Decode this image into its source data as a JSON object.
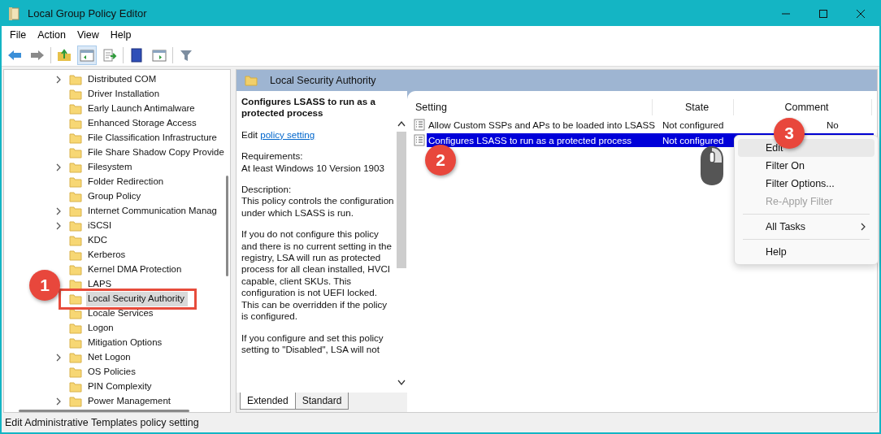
{
  "window": {
    "title": "Local Group Policy Editor"
  },
  "menu": [
    "File",
    "Action",
    "View",
    "Help"
  ],
  "tree": {
    "items": [
      {
        "label": "Distributed COM",
        "expandable": true,
        "selected": false
      },
      {
        "label": "Driver Installation",
        "expandable": false,
        "selected": false
      },
      {
        "label": "Early Launch Antimalware",
        "expandable": false,
        "selected": false
      },
      {
        "label": "Enhanced Storage Access",
        "expandable": false,
        "selected": false
      },
      {
        "label": "File Classification Infrastructure",
        "expandable": false,
        "selected": false
      },
      {
        "label": "File Share Shadow Copy Provide",
        "expandable": false,
        "selected": false
      },
      {
        "label": "Filesystem",
        "expandable": true,
        "selected": false
      },
      {
        "label": "Folder Redirection",
        "expandable": false,
        "selected": false
      },
      {
        "label": "Group Policy",
        "expandable": false,
        "selected": false
      },
      {
        "label": "Internet Communication Manag",
        "expandable": true,
        "selected": false
      },
      {
        "label": "iSCSI",
        "expandable": true,
        "selected": false
      },
      {
        "label": "KDC",
        "expandable": false,
        "selected": false
      },
      {
        "label": "Kerberos",
        "expandable": false,
        "selected": false
      },
      {
        "label": "Kernel DMA Protection",
        "expandable": false,
        "selected": false
      },
      {
        "label": "LAPS",
        "expandable": false,
        "selected": false
      },
      {
        "label": "Local Security Authority",
        "expandable": false,
        "selected": true
      },
      {
        "label": "Locale Services",
        "expandable": false,
        "selected": false
      },
      {
        "label": "Logon",
        "expandable": false,
        "selected": false
      },
      {
        "label": "Mitigation Options",
        "expandable": false,
        "selected": false
      },
      {
        "label": "Net Logon",
        "expandable": true,
        "selected": false
      },
      {
        "label": "OS Policies",
        "expandable": false,
        "selected": false
      },
      {
        "label": "PIN Complexity",
        "expandable": false,
        "selected": false
      },
      {
        "label": "Power Management",
        "expandable": true,
        "selected": false
      }
    ]
  },
  "details": {
    "header": "Local Security Authority",
    "policy_title": "Configures LSASS to run as a protected process",
    "edit_prefix": "Edit",
    "edit_link": "policy setting",
    "paragraphs": [
      "Requirements:\nAt least Windows 10 Version 1903",
      "Description:\nThis policy controls the configuration under which LSASS is run.",
      "If you do not configure this policy and there is no current setting in the registry, LSA will run as protected process for all clean installed, HVCI capable, client SKUs. This configuration is not UEFI locked. This can be overridden if the policy is configured.",
      "If you configure and set this policy setting to \"Disabled\", LSA will not"
    ],
    "tabs": [
      {
        "label": "Extended",
        "selected": true
      },
      {
        "label": "Standard",
        "selected": false
      }
    ]
  },
  "table": {
    "columns": [
      "Setting",
      "State",
      "Comment"
    ],
    "rows": [
      {
        "setting": "Allow Custom SSPs and APs to be loaded into LSASS",
        "state": "Not configured",
        "comment": "No",
        "selected": false
      },
      {
        "setting": "Configures LSASS to run as a protected process",
        "state": "Not configured",
        "selected": true
      }
    ]
  },
  "context_menu": {
    "items": [
      {
        "kind": "item",
        "label": "Edit",
        "highlighted": true,
        "disabled": false
      },
      {
        "kind": "item",
        "label": "Filter On",
        "highlighted": false,
        "disabled": false
      },
      {
        "kind": "item",
        "label": "Filter Options...",
        "highlighted": false,
        "disabled": false
      },
      {
        "kind": "item",
        "label": "Re-Apply Filter",
        "highlighted": false,
        "disabled": true
      },
      {
        "kind": "separator"
      },
      {
        "kind": "submenu",
        "label": "All Tasks",
        "highlighted": false,
        "disabled": false
      },
      {
        "kind": "separator"
      },
      {
        "kind": "item",
        "label": "Help",
        "highlighted": false,
        "disabled": false
      }
    ]
  },
  "annotations": [
    {
      "label": "1"
    },
    {
      "label": "2"
    },
    {
      "label": "3"
    }
  ],
  "status_bar": "Edit Administrative Templates policy setting"
}
